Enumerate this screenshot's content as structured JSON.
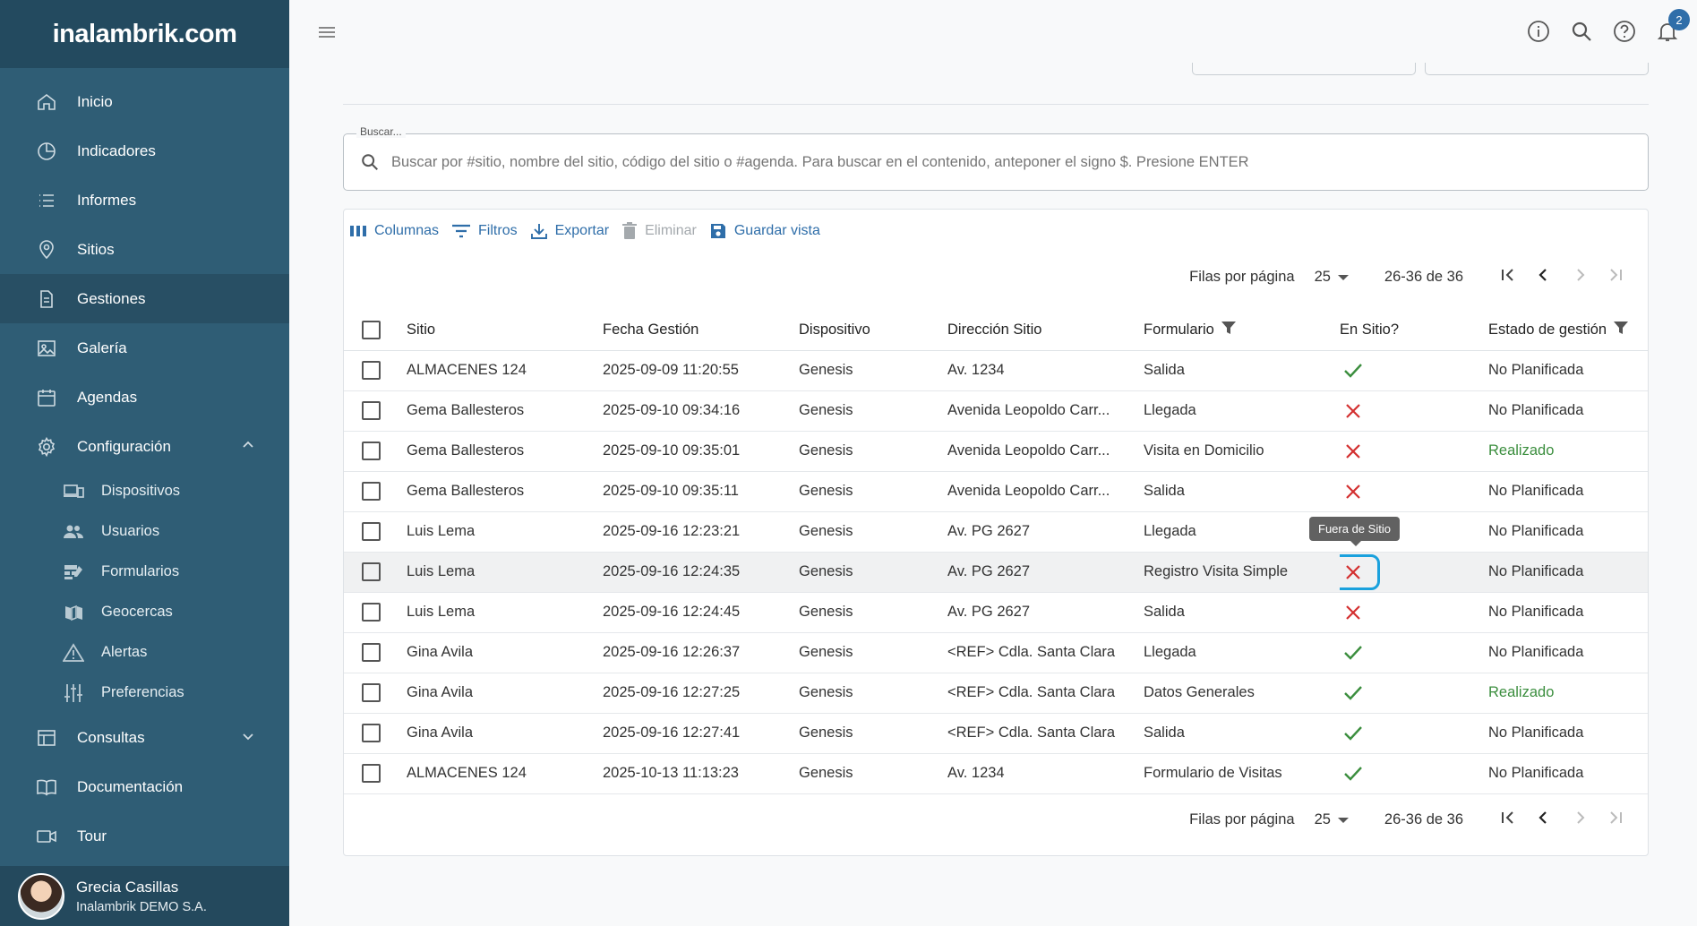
{
  "brand": {
    "logo_text": "inalambrik.com"
  },
  "sidebar": {
    "items": [
      {
        "label": "Inicio"
      },
      {
        "label": "Indicadores"
      },
      {
        "label": "Informes"
      },
      {
        "label": "Sitios"
      },
      {
        "label": "Gestiones"
      },
      {
        "label": "Galería"
      },
      {
        "label": "Agendas"
      },
      {
        "label": "Configuración"
      }
    ],
    "config_sub": [
      {
        "label": "Dispositivos"
      },
      {
        "label": "Usuarios"
      },
      {
        "label": "Formularios"
      },
      {
        "label": "Geocercas"
      },
      {
        "label": "Alertas"
      },
      {
        "label": "Preferencias"
      }
    ],
    "after": [
      {
        "label": "Consultas"
      },
      {
        "label": "Documentación"
      },
      {
        "label": "Tour"
      }
    ],
    "user": {
      "name": "Grecia Casillas",
      "org": "Inalambrik DEMO S.A."
    }
  },
  "topbar": {
    "notification_count": "2"
  },
  "search": {
    "label": "Buscar...",
    "placeholder": "Buscar por #sitio, nombre del sitio, código del sitio o #agenda. Para buscar en el contenido, anteponer el signo $. Presione ENTER"
  },
  "toolbar": {
    "columns": "Columnas",
    "filters": "Filtros",
    "export": "Exportar",
    "delete": "Eliminar",
    "save_view": "Guardar vista"
  },
  "pager": {
    "rows_per_page_label": "Filas por página",
    "rows_per_page": "25",
    "range": "26-36 de 36"
  },
  "table": {
    "headers": [
      "Sitio",
      "Fecha Gestión",
      "Dispositivo",
      "Dirección Sitio",
      "Formulario",
      "En Sitio?",
      "Estado de gestión"
    ],
    "rows": [
      {
        "sitio": "ALMACENES 124",
        "fecha": "2025-09-09 11:20:55",
        "dispositivo": "Genesis",
        "direccion": "Av. 1234",
        "formulario": "Salida",
        "en_sitio": true,
        "estado": "No Planificada"
      },
      {
        "sitio": "Gema Ballesteros",
        "fecha": "2025-09-10 09:34:16",
        "dispositivo": "Genesis",
        "direccion": "Avenida Leopoldo Carr...",
        "formulario": "Llegada",
        "en_sitio": false,
        "estado": "No Planificada"
      },
      {
        "sitio": "Gema Ballesteros",
        "fecha": "2025-09-10 09:35:01",
        "dispositivo": "Genesis",
        "direccion": "Avenida Leopoldo Carr...",
        "formulario": "Visita en Domicilio",
        "en_sitio": false,
        "estado": "Realizado"
      },
      {
        "sitio": "Gema Ballesteros",
        "fecha": "2025-09-10 09:35:11",
        "dispositivo": "Genesis",
        "direccion": "Avenida Leopoldo Carr...",
        "formulario": "Salida",
        "en_sitio": false,
        "estado": "No Planificada"
      },
      {
        "sitio": "Luis Lema",
        "fecha": "2025-09-16 12:23:21",
        "dispositivo": "Genesis",
        "direccion": "Av. PG 2627",
        "formulario": "Llegada",
        "en_sitio": null,
        "estado": "No Planificada"
      },
      {
        "sitio": "Luis Lema",
        "fecha": "2025-09-16 12:24:35",
        "dispositivo": "Genesis",
        "direccion": "Av. PG 2627",
        "formulario": "Registro Visita Simple",
        "en_sitio": false,
        "estado": "No Planificada"
      },
      {
        "sitio": "Luis Lema",
        "fecha": "2025-09-16 12:24:45",
        "dispositivo": "Genesis",
        "direccion": "Av. PG 2627",
        "formulario": "Salida",
        "en_sitio": false,
        "estado": "No Planificada"
      },
      {
        "sitio": "Gina Avila",
        "fecha": "2025-09-16 12:26:37",
        "dispositivo": "Genesis",
        "direccion": "<REF> Cdla. Santa Clara",
        "formulario": "Llegada",
        "en_sitio": true,
        "estado": "No Planificada"
      },
      {
        "sitio": "Gina Avila",
        "fecha": "2025-09-16 12:27:25",
        "dispositivo": "Genesis",
        "direccion": "<REF> Cdla. Santa Clara",
        "formulario": "Datos Generales",
        "en_sitio": true,
        "estado": "Realizado"
      },
      {
        "sitio": "Gina Avila",
        "fecha": "2025-09-16 12:27:41",
        "dispositivo": "Genesis",
        "direccion": "<REF> Cdla. Santa Clara",
        "formulario": "Salida",
        "en_sitio": true,
        "estado": "No Planificada"
      },
      {
        "sitio": "ALMACENES 124",
        "fecha": "2025-10-13 11:13:23",
        "dispositivo": "Genesis",
        "direccion": "Av. 1234",
        "formulario": "Formulario de Visitas",
        "en_sitio": true,
        "estado": "No Planificada"
      }
    ]
  },
  "tooltip": {
    "text": "Fuera de Sitio"
  },
  "colors": {
    "sidebar_bg": "#2f5d75",
    "accent": "#2f6ea9",
    "success": "#3b8e3e",
    "error": "#d32f2f",
    "focus_ring": "#1aa1dd"
  }
}
